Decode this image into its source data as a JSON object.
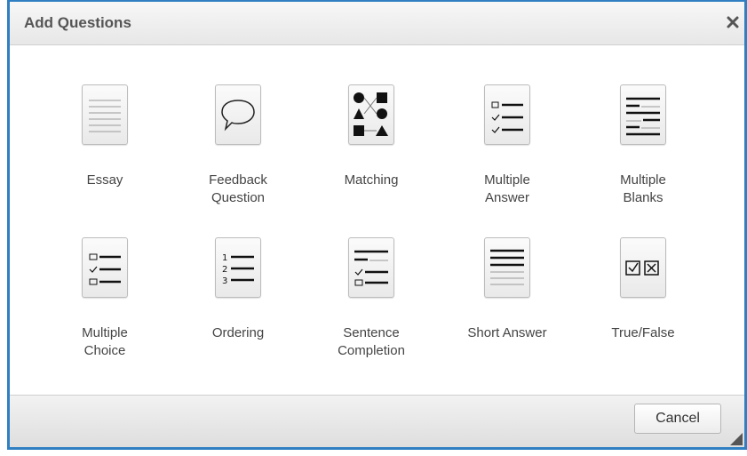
{
  "dialog": {
    "title": "Add Questions",
    "close_label": "×"
  },
  "question_types": [
    {
      "label": "Essay",
      "icon": "essay-icon"
    },
    {
      "label": "Feedback\nQuestion",
      "icon": "speech-bubble-icon"
    },
    {
      "label": "Matching",
      "icon": "matching-icon"
    },
    {
      "label": "Multiple\nAnswer",
      "icon": "checklist-icon"
    },
    {
      "label": "Multiple\nBlanks",
      "icon": "blanks-icon"
    },
    {
      "label": "Multiple\nChoice",
      "icon": "choice-list-icon"
    },
    {
      "label": "Ordering",
      "icon": "numbered-list-icon"
    },
    {
      "label": "Sentence\nCompletion",
      "icon": "sentence-completion-icon"
    },
    {
      "label": "Short Answer",
      "icon": "short-answer-icon"
    },
    {
      "label": "True/False",
      "icon": "true-false-icon"
    }
  ],
  "footer": {
    "cancel_label": "Cancel"
  },
  "colors": {
    "border_accent": "#2f7fc2",
    "text": "#444444",
    "icon_stroke": "#111111"
  }
}
